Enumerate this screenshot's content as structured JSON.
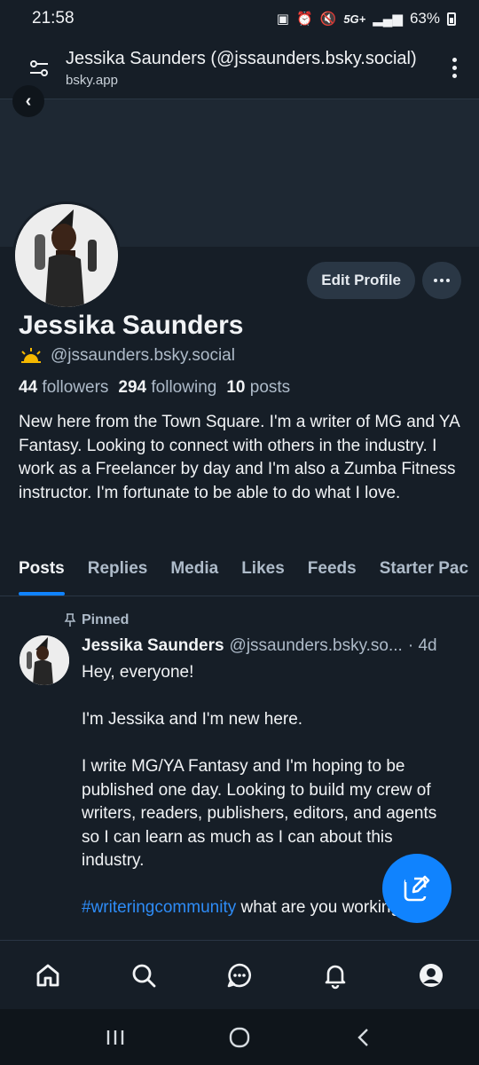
{
  "status_bar": {
    "time": "21:58",
    "network": "5G+",
    "battery": "63%"
  },
  "browser": {
    "title": "Jessika Saunders (@jssaunders.bsky.social)",
    "domain": "bsky.app"
  },
  "profile": {
    "name": "Jessika Saunders",
    "handle": "@jssaunders.bsky.social",
    "followers_count": "44",
    "followers_label": "followers",
    "following_count": "294",
    "following_label": "following",
    "posts_count": "10",
    "posts_label": "posts",
    "bio": "New here from the Town Square. I'm a writer of MG and YA Fantasy. Looking to connect with others in the industry. I work as a Freelancer by day and I'm also a Zumba Fitness instructor. I'm fortunate to be able to do what I love.",
    "edit_button": "Edit Profile"
  },
  "tabs": [
    {
      "label": "Posts",
      "active": true
    },
    {
      "label": "Replies",
      "active": false
    },
    {
      "label": "Media",
      "active": false
    },
    {
      "label": "Likes",
      "active": false
    },
    {
      "label": "Feeds",
      "active": false
    },
    {
      "label": "Starter Pac",
      "active": false
    }
  ],
  "post": {
    "pinned_label": "Pinned",
    "author_name": "Jessika Saunders",
    "author_handle": "@jssaunders.bsky.so...",
    "time": "· 4d",
    "paragraphs": [
      "Hey, everyone!",
      "I'm Jessika and I'm new here.",
      "I write MG/YA Fantasy and I'm hoping to be published one day. Looking to build my crew of writers, readers, publishers, editors, and agents so I can learn as much as I can about this industry."
    ],
    "hashtag": "#writeringcommunity",
    "tail_text": " what are you working on?"
  },
  "colors": {
    "background": "#161e27",
    "accent": "#1083fe",
    "muted_text": "#aebbc9",
    "button_bg": "#2a3745"
  },
  "icons": {
    "nav": [
      "home-icon",
      "search-icon",
      "chat-icon",
      "bell-icon",
      "profile-icon"
    ],
    "fab": "compose-icon",
    "system": [
      "recents-icon",
      "home-circle-icon",
      "back-chevron-icon"
    ]
  }
}
